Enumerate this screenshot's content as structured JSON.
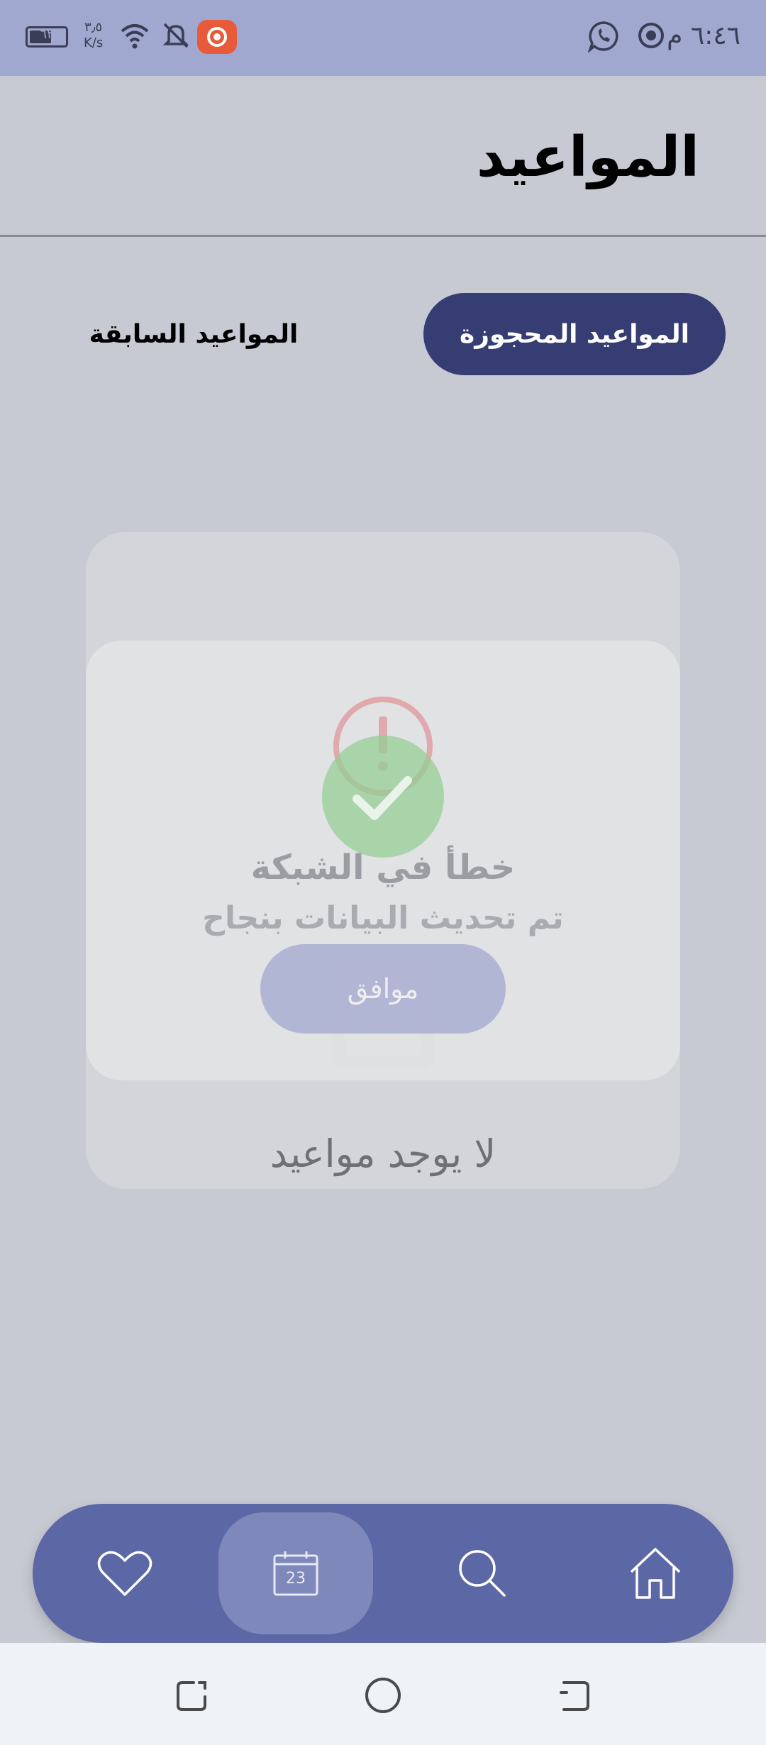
{
  "status_bar": {
    "time": "٦:٤٦ م",
    "battery": "٦٢",
    "net_speed_value": "٣٫٥",
    "net_speed_unit": "K/s",
    "icons": [
      "whatsapp-icon",
      "record-icon",
      "wifi-icon",
      "notifications-off-icon",
      "screen-record-icon",
      "battery-icon"
    ]
  },
  "header": {
    "title": "المواعيد"
  },
  "tabs": [
    {
      "label": "المواعيد المحجوزة",
      "active": true
    },
    {
      "label": "المواعيد السابقة",
      "active": false
    }
  ],
  "empty_state": {
    "icon": "calendar-icon",
    "text": "لا يوجد مواعيد"
  },
  "dialog": {
    "error_title": "خطأ في الشبكة",
    "success_message": "تم تحديث البيانات بنجاح",
    "ok_button": "موافق",
    "icons": [
      "error-icon",
      "success-check-icon"
    ]
  },
  "bottom_nav": {
    "items": [
      {
        "icon": "heart-icon"
      },
      {
        "icon": "calendar-icon",
        "day": "23",
        "active": true
      },
      {
        "icon": "search-icon"
      },
      {
        "icon": "home-icon"
      }
    ]
  },
  "system_nav": [
    "recents-icon",
    "home-circle-icon",
    "back-icon"
  ],
  "colors": {
    "accent": "#363d73",
    "nav_bar": "#5c67a6",
    "status_bar": "#a0a8d0",
    "background": "#c8cad3"
  }
}
